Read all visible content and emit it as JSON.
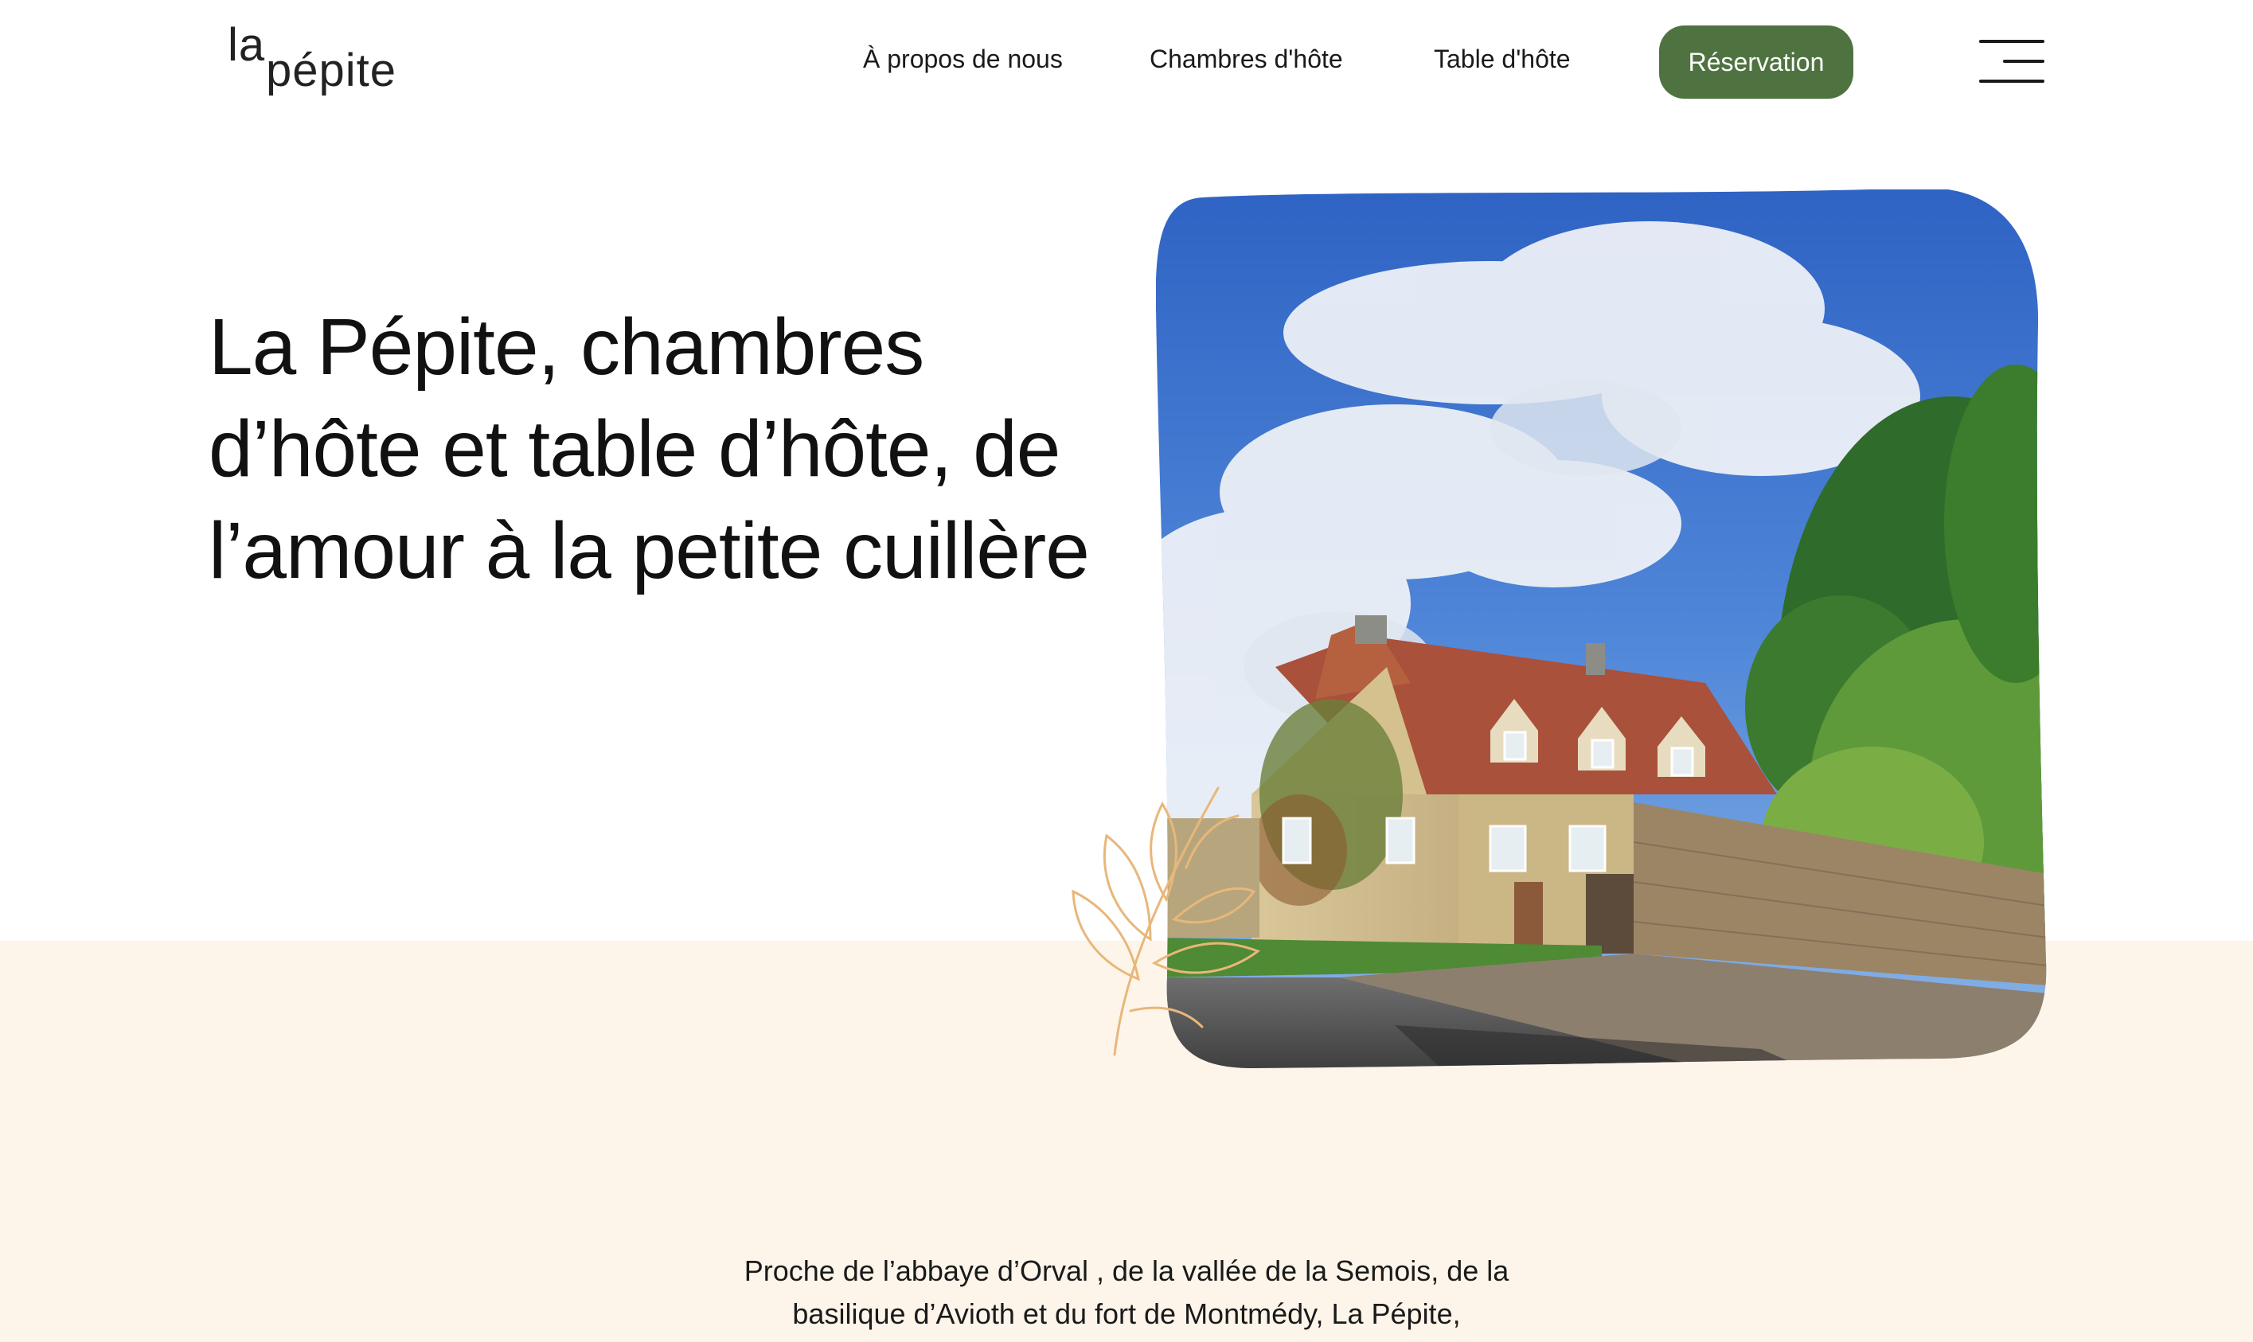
{
  "brand": {
    "logo_line1": "la",
    "logo_line2": "pépite"
  },
  "nav": {
    "items": [
      {
        "label": "À propos de nous"
      },
      {
        "label": "Chambres d'hôte"
      },
      {
        "label": "Table d'hôte"
      }
    ],
    "reservation_label": "Réservation",
    "menu_icon": "hamburger-menu-icon"
  },
  "hero": {
    "title": "La Pépite, chambres d’hôte et table d’hôte, de l’amour à la petite cuillère",
    "image_description_icon": "house-photo",
    "decoration_icon": "leaf-branch-icon"
  },
  "intro": {
    "text": "Proche de l’abbaye d’Orval , de la vallée de la Semois, de la basilique d’Avioth et du fort de Montmédy, La Pépite,"
  },
  "colors": {
    "accent": "#4f7340",
    "cream": "#fdf5ea",
    "branch": "#e8b77a"
  }
}
